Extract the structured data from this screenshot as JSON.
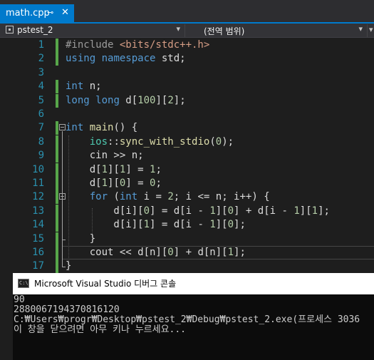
{
  "tab": {
    "label": "math.cpp",
    "pin_glyph": "⊸",
    "close_glyph": "✕"
  },
  "navbar": {
    "project": "pstest_2",
    "scope": "(전역 범위)",
    "arrow": "▾"
  },
  "editor": {
    "line_numbers": [
      "1",
      "2",
      "3",
      "4",
      "5",
      "6",
      "7",
      "8",
      "9",
      "10",
      "11",
      "12",
      "13",
      "14",
      "15",
      "16",
      "17"
    ],
    "colors": {
      "keyword": "#569cd6",
      "string": "#d69d85",
      "number": "#b5cea8",
      "function": "#dcdcaa",
      "namespace": "#4ec9b0",
      "identifier": "#dcdcdc",
      "line_number": "#2b91af",
      "change_bar": "#57a64a"
    },
    "lines": [
      [
        {
          "t": "#include ",
          "c": "pp"
        },
        {
          "t": "<bits/stdc++.h>",
          "c": "str"
        }
      ],
      [
        {
          "t": "using",
          "c": "kw"
        },
        {
          "t": " ",
          "c": "id"
        },
        {
          "t": "namespace",
          "c": "kw"
        },
        {
          "t": " std;",
          "c": "id"
        }
      ],
      [],
      [
        {
          "t": "int",
          "c": "kw"
        },
        {
          "t": " n;",
          "c": "id"
        }
      ],
      [
        {
          "t": "long",
          "c": "kw"
        },
        {
          "t": " ",
          "c": "id"
        },
        {
          "t": "long",
          "c": "kw"
        },
        {
          "t": " d[",
          "c": "id"
        },
        {
          "t": "100",
          "c": "num"
        },
        {
          "t": "][",
          "c": "id"
        },
        {
          "t": "2",
          "c": "num"
        },
        {
          "t": "];",
          "c": "id"
        }
      ],
      [],
      [
        {
          "t": "int",
          "c": "kw"
        },
        {
          "t": " ",
          "c": "id"
        },
        {
          "t": "main",
          "c": "fn"
        },
        {
          "t": "() {",
          "c": "id"
        }
      ],
      [
        {
          "t": "    ",
          "c": "id"
        },
        {
          "t": "ios",
          "c": "ns"
        },
        {
          "t": "::",
          "c": "id"
        },
        {
          "t": "sync_with_stdio",
          "c": "fn"
        },
        {
          "t": "(",
          "c": "id"
        },
        {
          "t": "0",
          "c": "num"
        },
        {
          "t": ");",
          "c": "id"
        }
      ],
      [
        {
          "t": "    cin >> n;",
          "c": "id"
        }
      ],
      [
        {
          "t": "    d[",
          "c": "id"
        },
        {
          "t": "1",
          "c": "num"
        },
        {
          "t": "][",
          "c": "id"
        },
        {
          "t": "1",
          "c": "num"
        },
        {
          "t": "] = ",
          "c": "id"
        },
        {
          "t": "1",
          "c": "num"
        },
        {
          "t": ";",
          "c": "id"
        }
      ],
      [
        {
          "t": "    d[",
          "c": "id"
        },
        {
          "t": "1",
          "c": "num"
        },
        {
          "t": "][",
          "c": "id"
        },
        {
          "t": "0",
          "c": "num"
        },
        {
          "t": "] = ",
          "c": "id"
        },
        {
          "t": "0",
          "c": "num"
        },
        {
          "t": ";",
          "c": "id"
        }
      ],
      [
        {
          "t": "    ",
          "c": "id"
        },
        {
          "t": "for",
          "c": "kw"
        },
        {
          "t": " (",
          "c": "id"
        },
        {
          "t": "int",
          "c": "kw"
        },
        {
          "t": " i = ",
          "c": "id"
        },
        {
          "t": "2",
          "c": "num"
        },
        {
          "t": "; i <= n; i++) {",
          "c": "id"
        }
      ],
      [
        {
          "t": "        d[i][",
          "c": "id"
        },
        {
          "t": "0",
          "c": "num"
        },
        {
          "t": "] = d[i - ",
          "c": "id"
        },
        {
          "t": "1",
          "c": "num"
        },
        {
          "t": "][",
          "c": "id"
        },
        {
          "t": "0",
          "c": "num"
        },
        {
          "t": "] + d[i - ",
          "c": "id"
        },
        {
          "t": "1",
          "c": "num"
        },
        {
          "t": "][",
          "c": "id"
        },
        {
          "t": "1",
          "c": "num"
        },
        {
          "t": "];",
          "c": "id"
        }
      ],
      [
        {
          "t": "        d[i][",
          "c": "id"
        },
        {
          "t": "1",
          "c": "num"
        },
        {
          "t": "] = d[i - ",
          "c": "id"
        },
        {
          "t": "1",
          "c": "num"
        },
        {
          "t": "][",
          "c": "id"
        },
        {
          "t": "0",
          "c": "num"
        },
        {
          "t": "];",
          "c": "id"
        }
      ],
      [
        {
          "t": "    }",
          "c": "id"
        }
      ],
      [
        {
          "t": "    cout << d[n][",
          "c": "id"
        },
        {
          "t": "0",
          "c": "num"
        },
        {
          "t": "] + d[n][",
          "c": "id"
        },
        {
          "t": "1",
          "c": "num"
        },
        {
          "t": "];",
          "c": "id"
        }
      ],
      [
        {
          "t": "}",
          "c": "id"
        }
      ]
    ]
  },
  "console": {
    "title": "Microsoft Visual Studio 디버그 콘솔",
    "icon_text": "C:\\",
    "output": [
      "90",
      "2880067194370816120",
      "C:₩Users₩progr₩Desktop₩pstest_2₩Debug₩pstest_2.exe(프로세스 3036",
      "이 창을 닫으려면 아무 키나 누르세요..."
    ]
  }
}
